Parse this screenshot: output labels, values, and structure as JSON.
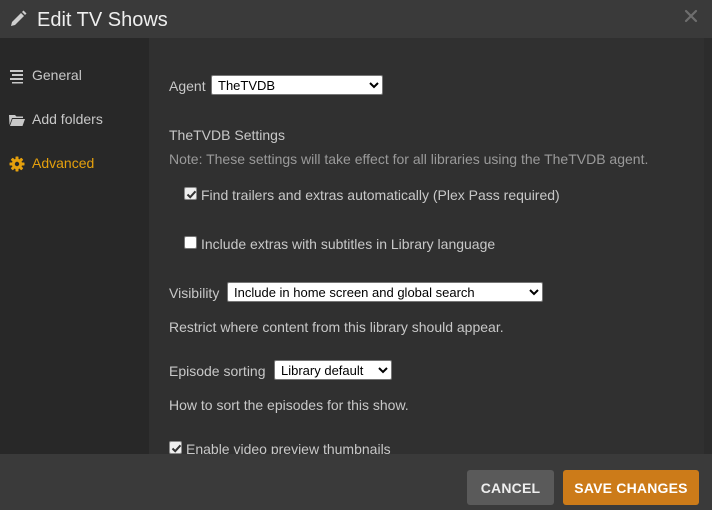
{
  "dialog": {
    "title": "Edit TV Shows",
    "title_icon": "pencil-icon",
    "close_icon": "close-icon"
  },
  "sidebar": {
    "items": [
      {
        "label": "General",
        "icon": "list-icon",
        "active": false
      },
      {
        "label": "Add folders",
        "icon": "folder-icon",
        "active": false
      },
      {
        "label": "Advanced",
        "icon": "gear-icon",
        "active": true
      }
    ],
    "active_color": "#e5a00d"
  },
  "content": {
    "agent": {
      "label": "Agent",
      "value": "TheTVDB"
    },
    "settings_heading": "TheTVDB Settings",
    "settings_note": "Note: These settings will take effect for all libraries using the TheTVDB agent.",
    "find_trailers": {
      "label": "Find trailers and extras automatically (Plex Pass required)",
      "checked": true
    },
    "include_extras": {
      "label": "Include extras with subtitles in Library language",
      "checked": false
    },
    "visibility": {
      "label": "Visibility",
      "value": "Include in home screen and global search",
      "help": "Restrict where content from this library should appear."
    },
    "episode_sorting": {
      "label": "Episode sorting",
      "value": "Library default",
      "help": "How to sort the episodes for this show."
    },
    "preview_thumbnails": {
      "label": "Enable video preview thumbnails",
      "checked": true
    }
  },
  "footer": {
    "cancel_label": "CANCEL",
    "save_label": "SAVE CHANGES",
    "save_color": "#cc7b19"
  }
}
